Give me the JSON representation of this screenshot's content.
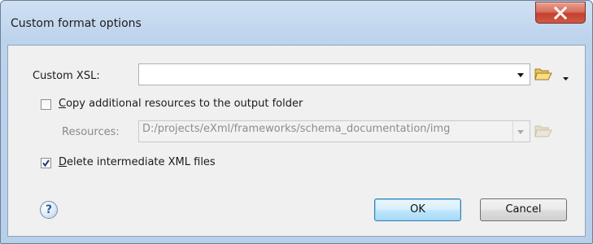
{
  "dialog": {
    "title": "Custom format options",
    "close_label": "X"
  },
  "custom_xsl": {
    "label": "Custom XSL:",
    "value": ""
  },
  "copy_resources": {
    "label_mnemonic": "C",
    "label_rest": "opy additional resources to the output folder",
    "checked": false
  },
  "resources": {
    "label": "Resources:",
    "value": "D:/projects/eXml/frameworks/schema_documentation/img",
    "enabled": false
  },
  "delete_intermediate": {
    "label_mnemonic": "D",
    "label_rest": "elete intermediate XML files",
    "checked": true
  },
  "buttons": {
    "help": "?",
    "ok": "OK",
    "cancel": "Cancel"
  },
  "icons": {
    "folder": "folder-open-icon",
    "dropdown": "chevron-down-icon",
    "help": "help-icon",
    "close": "close-icon"
  },
  "colors": {
    "title_bar": "#bcd3ec",
    "close_button": "#c4402e",
    "dialog_bg": "#f0f0f0",
    "default_button_border": "#3c7fb1"
  }
}
